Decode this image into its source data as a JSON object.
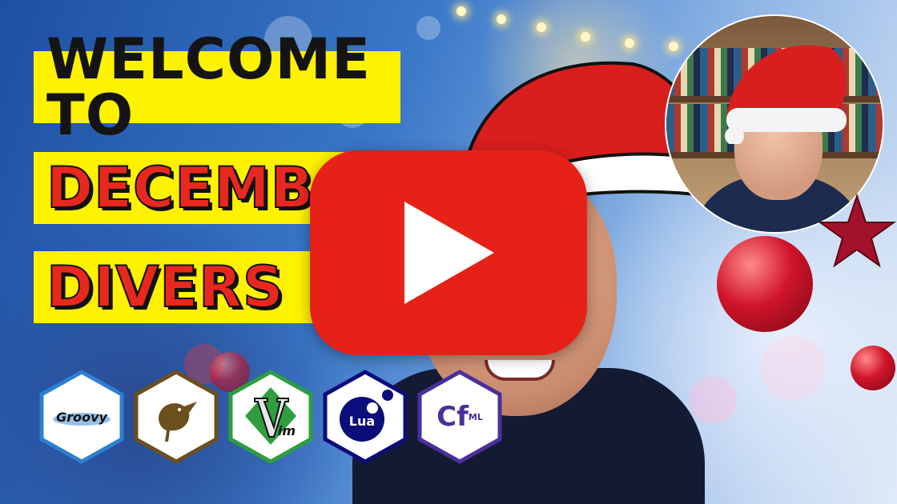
{
  "title": {
    "line1": "WELCOME TO",
    "line2": "DECEMB",
    "line3": "DIVERS"
  },
  "colors": {
    "title_highlight": "#fff200",
    "title_red": "#e8281f",
    "play_button": "#e62117",
    "badge_groovy": "#2f7fd1",
    "badge_bird": "#6b4f1d",
    "badge_vim": "#2e9e3e",
    "badge_lua": "#0b0d7a",
    "badge_cfml": "#4b2f9b"
  },
  "badges": [
    {
      "name": "groovy-icon",
      "label": "Groovy"
    },
    {
      "name": "bird-icon",
      "label": ""
    },
    {
      "name": "vim-icon",
      "label": "im"
    },
    {
      "name": "lua-icon",
      "label": "Lua"
    },
    {
      "name": "cfml-icon",
      "label": "Cf",
      "sup": "ML"
    }
  ],
  "play_button": {
    "icon": "play-icon"
  }
}
